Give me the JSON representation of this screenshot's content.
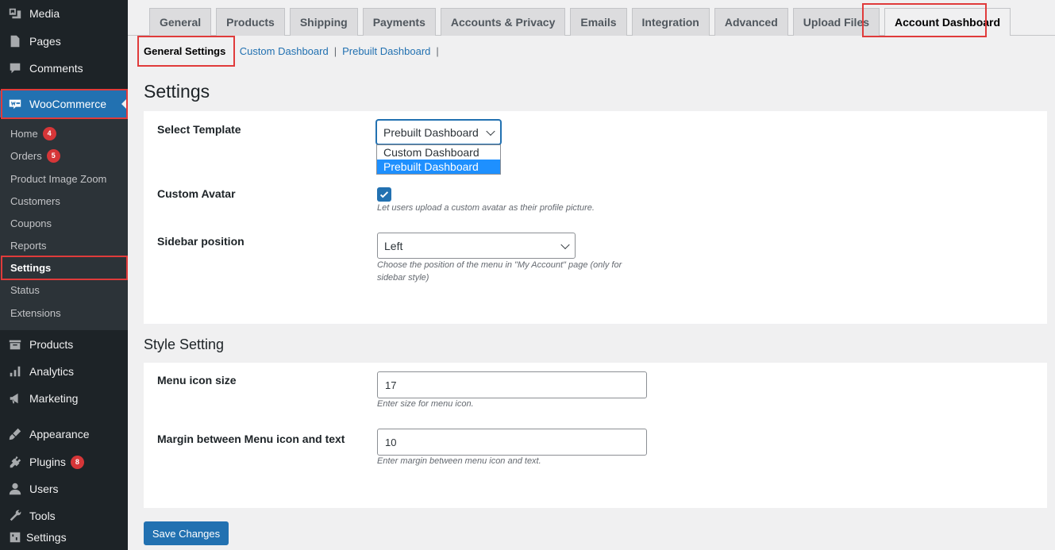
{
  "sidebar": {
    "top_items": [
      {
        "label": "Media",
        "icon": "media-icon"
      },
      {
        "label": "Pages",
        "icon": "pages-icon"
      },
      {
        "label": "Comments",
        "icon": "comments-icon"
      }
    ],
    "woocommerce": {
      "label": "WooCommerce",
      "icon": "woocommerce-icon"
    },
    "submenu": [
      {
        "label": "Home",
        "badge": "4"
      },
      {
        "label": "Orders",
        "badge": "5"
      },
      {
        "label": "Product Image Zoom"
      },
      {
        "label": "Customers"
      },
      {
        "label": "Coupons"
      },
      {
        "label": "Reports"
      },
      {
        "label": "Settings",
        "current": true
      },
      {
        "label": "Status"
      },
      {
        "label": "Extensions"
      }
    ],
    "bottom_items": [
      {
        "label": "Products",
        "icon": "products-icon"
      },
      {
        "label": "Analytics",
        "icon": "analytics-icon"
      },
      {
        "label": "Marketing",
        "icon": "marketing-icon"
      },
      {
        "label": "Appearance",
        "icon": "appearance-icon"
      },
      {
        "label": "Plugins",
        "icon": "plugins-icon",
        "badge": "8"
      },
      {
        "label": "Users",
        "icon": "users-icon"
      },
      {
        "label": "Tools",
        "icon": "tools-icon"
      },
      {
        "label": "Settings",
        "icon": "settings-icon"
      }
    ]
  },
  "tabs": [
    "General",
    "Products",
    "Shipping",
    "Payments",
    "Accounts & Privacy",
    "Emails",
    "Integration",
    "Advanced",
    "Upload Files",
    "Account Dashboard"
  ],
  "active_tab": "Account Dashboard",
  "subsubsub": {
    "current": "General Settings",
    "links": [
      "Custom Dashboard",
      "Prebuilt Dashboard"
    ],
    "separator": "|"
  },
  "settings_section": {
    "title": "Settings",
    "select_template": {
      "label": "Select Template",
      "value": "Prebuilt Dashboard",
      "options": [
        "Custom Dashboard",
        "Prebuilt Dashboard"
      ],
      "highlighted": "Prebuilt Dashboard"
    },
    "custom_avatar": {
      "label": "Custom Avatar",
      "checked": true,
      "description": "Let users upload a custom avatar as their profile picture."
    },
    "sidebar_position": {
      "label": "Sidebar position",
      "value": "Left",
      "description": "Choose the position of the menu in \"My Account\" page (only for sidebar style)"
    }
  },
  "style_section": {
    "title": "Style Setting",
    "menu_icon_size": {
      "label": "Menu icon size",
      "value": "17",
      "description": "Enter size for menu icon."
    },
    "margin": {
      "label": "Margin between Menu icon and text",
      "value": "10",
      "description": "Enter margin between menu icon and text."
    }
  },
  "save_button": "Save Changes",
  "colors": {
    "sidebar_bg": "#1d2327",
    "accent": "#2271b1",
    "highlight_box": "#e03b3b",
    "badge": "#d63638"
  }
}
